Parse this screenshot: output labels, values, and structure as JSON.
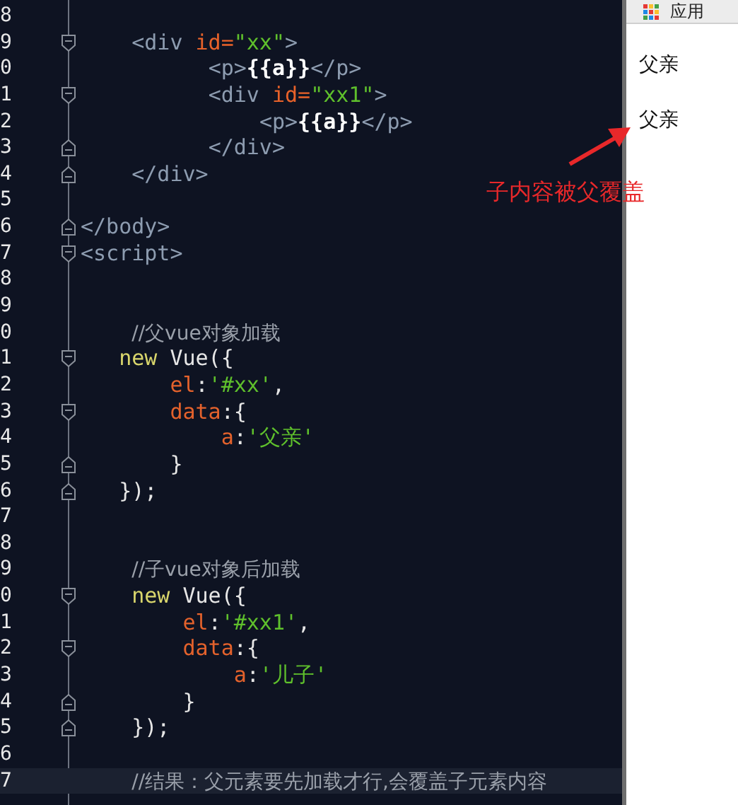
{
  "editor": {
    "lines": [
      {
        "number": "8",
        "kind": "plain",
        "current": false
      },
      {
        "number": "9",
        "kind": "opener",
        "current": false,
        "tokens": [
          {
            "kind": "tag",
            "text": "    <div "
          },
          {
            "kind": "attr",
            "text": "id="
          },
          {
            "kind": "string",
            "text": "\"xx\""
          },
          {
            "kind": "tag",
            "text": ">"
          }
        ]
      },
      {
        "number": "0",
        "kind": "plain",
        "current": false,
        "tokens": [
          {
            "kind": "tag",
            "text": "          <p>"
          },
          {
            "kind": "mustache",
            "text": "{{a}}"
          },
          {
            "kind": "tag",
            "text": "</p>"
          }
        ]
      },
      {
        "number": "1",
        "kind": "opener",
        "current": false,
        "tokens": [
          {
            "kind": "tag",
            "text": "          <div "
          },
          {
            "kind": "attr",
            "text": "id="
          },
          {
            "kind": "string",
            "text": "\"xx1\""
          },
          {
            "kind": "tag",
            "text": ">"
          }
        ]
      },
      {
        "number": "2",
        "kind": "plain",
        "current": false,
        "tokens": [
          {
            "kind": "tag",
            "text": "              <p>"
          },
          {
            "kind": "mustache",
            "text": "{{a}}"
          },
          {
            "kind": "tag",
            "text": "</p>"
          }
        ]
      },
      {
        "number": "3",
        "kind": "closer",
        "current": false,
        "tokens": [
          {
            "kind": "tag",
            "text": "          </div>"
          }
        ]
      },
      {
        "number": "4",
        "kind": "closer",
        "current": false,
        "tokens": [
          {
            "kind": "tag",
            "text": "    </div>"
          }
        ]
      },
      {
        "number": "5",
        "kind": "plain",
        "current": false
      },
      {
        "number": "6",
        "kind": "closer",
        "current": false,
        "tokens": [
          {
            "kind": "tag",
            "text": "</body>"
          }
        ]
      },
      {
        "number": "7",
        "kind": "opener",
        "current": false,
        "tokens": [
          {
            "kind": "tag",
            "text": "<script>"
          }
        ]
      },
      {
        "number": "8",
        "kind": "plain",
        "current": false
      },
      {
        "number": "9",
        "kind": "plain",
        "current": false
      },
      {
        "number": "0",
        "kind": "plain",
        "current": false,
        "tokens": [
          {
            "kind": "comment",
            "text": "    //父vue对象加载"
          }
        ]
      },
      {
        "number": "1",
        "kind": "opener",
        "current": false,
        "tokens": [
          {
            "kind": "keyword",
            "text": "   new"
          },
          {
            "kind": "plain",
            "text": " Vue({"
          }
        ]
      },
      {
        "number": "2",
        "kind": "plain",
        "current": false,
        "tokens": [
          {
            "kind": "prop",
            "text": "       el"
          },
          {
            "kind": "plain",
            "text": ":"
          },
          {
            "kind": "string",
            "text": "'#xx'"
          },
          {
            "kind": "plain",
            "text": ","
          }
        ]
      },
      {
        "number": "3",
        "kind": "opener",
        "current": false,
        "tokens": [
          {
            "kind": "prop",
            "text": "       data"
          },
          {
            "kind": "plain",
            "text": ":{"
          }
        ]
      },
      {
        "number": "4",
        "kind": "plain",
        "current": false,
        "tokens": [
          {
            "kind": "prop",
            "text": "           a"
          },
          {
            "kind": "plain",
            "text": ":"
          },
          {
            "kind": "string",
            "text": "'父亲'"
          }
        ]
      },
      {
        "number": "5",
        "kind": "closer",
        "current": false,
        "tokens": [
          {
            "kind": "plain",
            "text": "       }"
          }
        ]
      },
      {
        "number": "6",
        "kind": "closer",
        "current": false,
        "tokens": [
          {
            "kind": "plain",
            "text": "   });"
          }
        ]
      },
      {
        "number": "7",
        "kind": "plain",
        "current": false
      },
      {
        "number": "8",
        "kind": "plain",
        "current": false
      },
      {
        "number": "9",
        "kind": "plain",
        "current": false,
        "tokens": [
          {
            "kind": "comment",
            "text": "    //子vue对象后加载"
          }
        ]
      },
      {
        "number": "0",
        "kind": "opener",
        "current": false,
        "tokens": [
          {
            "kind": "keyword",
            "text": "    new"
          },
          {
            "kind": "plain",
            "text": " Vue({"
          }
        ]
      },
      {
        "number": "1",
        "kind": "plain",
        "current": false,
        "tokens": [
          {
            "kind": "prop",
            "text": "        el"
          },
          {
            "kind": "plain",
            "text": ":"
          },
          {
            "kind": "string",
            "text": "'#xx1'"
          },
          {
            "kind": "plain",
            "text": ","
          }
        ]
      },
      {
        "number": "2",
        "kind": "opener",
        "current": false,
        "tokens": [
          {
            "kind": "prop",
            "text": "        data"
          },
          {
            "kind": "plain",
            "text": ":{"
          }
        ]
      },
      {
        "number": "3",
        "kind": "plain",
        "current": false,
        "tokens": [
          {
            "kind": "prop",
            "text": "            a"
          },
          {
            "kind": "plain",
            "text": ":"
          },
          {
            "kind": "string",
            "text": "'儿子'"
          }
        ]
      },
      {
        "number": "4",
        "kind": "closer",
        "current": false,
        "tokens": [
          {
            "kind": "plain",
            "text": "        }"
          }
        ]
      },
      {
        "number": "5",
        "kind": "closer",
        "current": false,
        "tokens": [
          {
            "kind": "plain",
            "text": "    });"
          }
        ]
      },
      {
        "number": "6",
        "kind": "plain",
        "current": false
      },
      {
        "number": "7",
        "kind": "plain",
        "current": true,
        "tokens": [
          {
            "kind": "comment",
            "text": "    //结果：父元素要先加载才行,会覆盖子元素内容"
          }
        ]
      }
    ]
  },
  "browser": {
    "apps_label": "应用",
    "paragraphs": [
      "父亲",
      "父亲"
    ]
  },
  "annotation": {
    "text": "子内容被父覆盖"
  }
}
